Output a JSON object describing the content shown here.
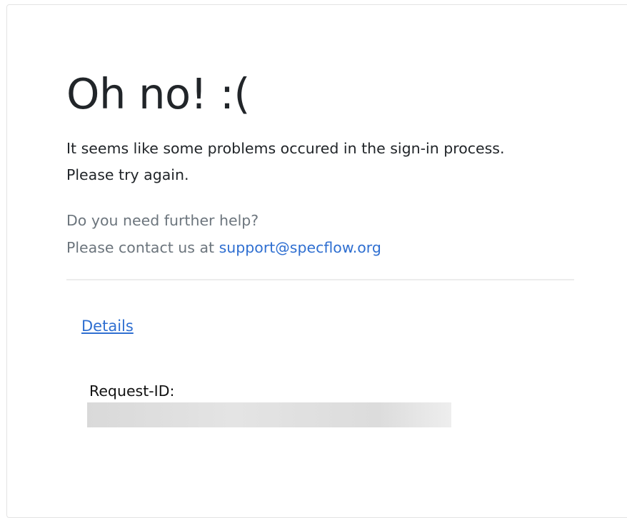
{
  "page": {
    "title": "Oh no! :(",
    "message_line_1": "It seems like some problems occured in the sign-in process.",
    "message_line_2": "Please try again.",
    "help_question": "Do you need further help?",
    "help_contact_prefix": "Please contact us at ",
    "support_email": "support@specflow.org",
    "details_link_label": "Details",
    "request_id_label": "Request-ID:",
    "request_id_value": ""
  },
  "colors": {
    "link": "#2f6fd1",
    "heading": "#212529",
    "muted_text": "#6c757d",
    "redaction_bar": "#dcdcdc"
  }
}
